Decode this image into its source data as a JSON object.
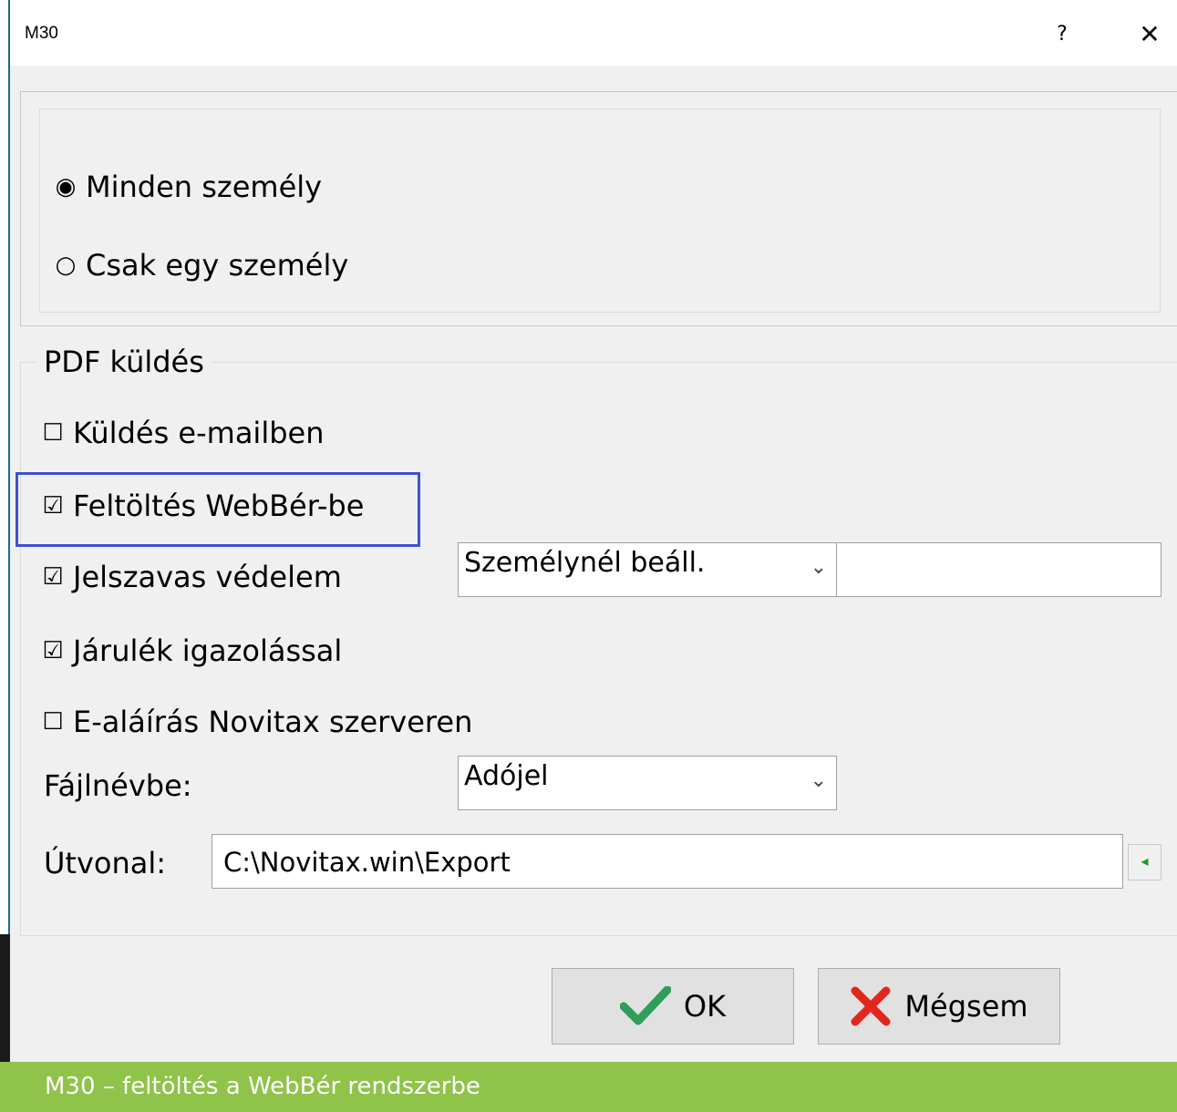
{
  "window": {
    "title": "M30",
    "help_label": "?",
    "close_label": "✕"
  },
  "scope": {
    "options": [
      {
        "label": "Minden személy",
        "selected": true
      },
      {
        "label": "Csak egy személy",
        "selected": false
      }
    ]
  },
  "pdf": {
    "legend": "PDF küldés",
    "checkboxes": [
      {
        "label": "Küldés e-mailben",
        "checked": false
      },
      {
        "label": "Feltöltés WebBér-be",
        "checked": true
      },
      {
        "label": "Jelszavas védelem",
        "checked": true
      },
      {
        "label": "Járulék igazolással",
        "checked": true
      },
      {
        "label": "E-aláírás Novitax szerveren",
        "checked": false
      }
    ],
    "password_mode": "Személynél beáll.",
    "password_value": "",
    "filename_label": "Fájlnévbe:",
    "filename_value": "Adójel",
    "path_label": "Útvonal:",
    "path_value": "C:\\Novitax.win\\Export"
  },
  "icons": {
    "radio_on": "◉",
    "radio_off": "○",
    "check_on": "☑",
    "check_off": "☐",
    "dropdown": "⌄",
    "browse": "◂"
  },
  "buttons": {
    "ok_label": "OK",
    "cancel_label": "Mégsem"
  },
  "colors": {
    "highlight": "#3f51d0",
    "ok_check": "#2e9e5a",
    "cancel_x": "#e2261c",
    "caption_bg": "#8fc34a"
  },
  "caption": "M30 – feltöltés a WebBér rendszerbe"
}
